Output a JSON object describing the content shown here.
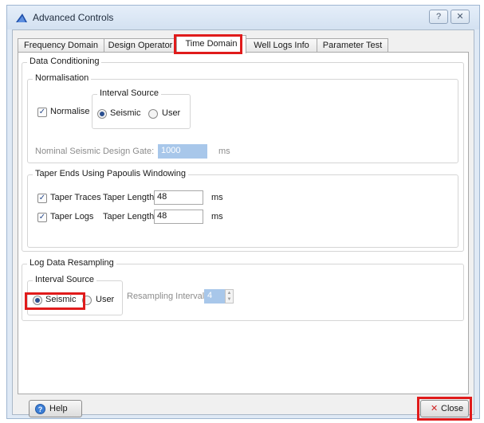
{
  "window": {
    "title": "Advanced Controls",
    "help_glyph": "?",
    "close_glyph": "✕"
  },
  "tabs": [
    {
      "label": "Frequency Domain"
    },
    {
      "label": "Design Operator"
    },
    {
      "label": "Time Domain"
    },
    {
      "label": "Well Logs Info"
    },
    {
      "label": "Parameter Test"
    }
  ],
  "data_conditioning": {
    "title": "Data Conditioning",
    "normalisation": {
      "title": "Normalisation",
      "normalise_label": "Normalise",
      "normalise_checked": true,
      "interval_source": {
        "title": "Interval Source",
        "seismic_label": "Seismic",
        "user_label": "User",
        "selected": "Seismic"
      },
      "gate_label": "Nominal Seismic Design Gate:",
      "gate_value": "1000",
      "gate_unit": "ms"
    },
    "taper": {
      "title": "Taper Ends Using Papoulis Windowing",
      "traces_label": "Taper Traces",
      "traces_checked": true,
      "traces_length_label": "Taper Length:",
      "traces_length_value": "48",
      "traces_unit": "ms",
      "logs_label": "Taper Logs",
      "logs_checked": true,
      "logs_length_label": "Taper Length:",
      "logs_length_value": "48",
      "logs_unit": "ms"
    }
  },
  "log_resampling": {
    "title": "Log Data Resampling",
    "interval_source": {
      "title": "Interval Source",
      "seismic_label": "Seismic",
      "user_label": "User",
      "selected": "Seismic"
    },
    "interval_label": "Resampling Interval:",
    "interval_value": "4"
  },
  "footer": {
    "help_label": "Help",
    "close_label": "Close"
  },
  "colors": {
    "highlight": "#e01b1b",
    "disabled_field": "#a8c7ea"
  }
}
